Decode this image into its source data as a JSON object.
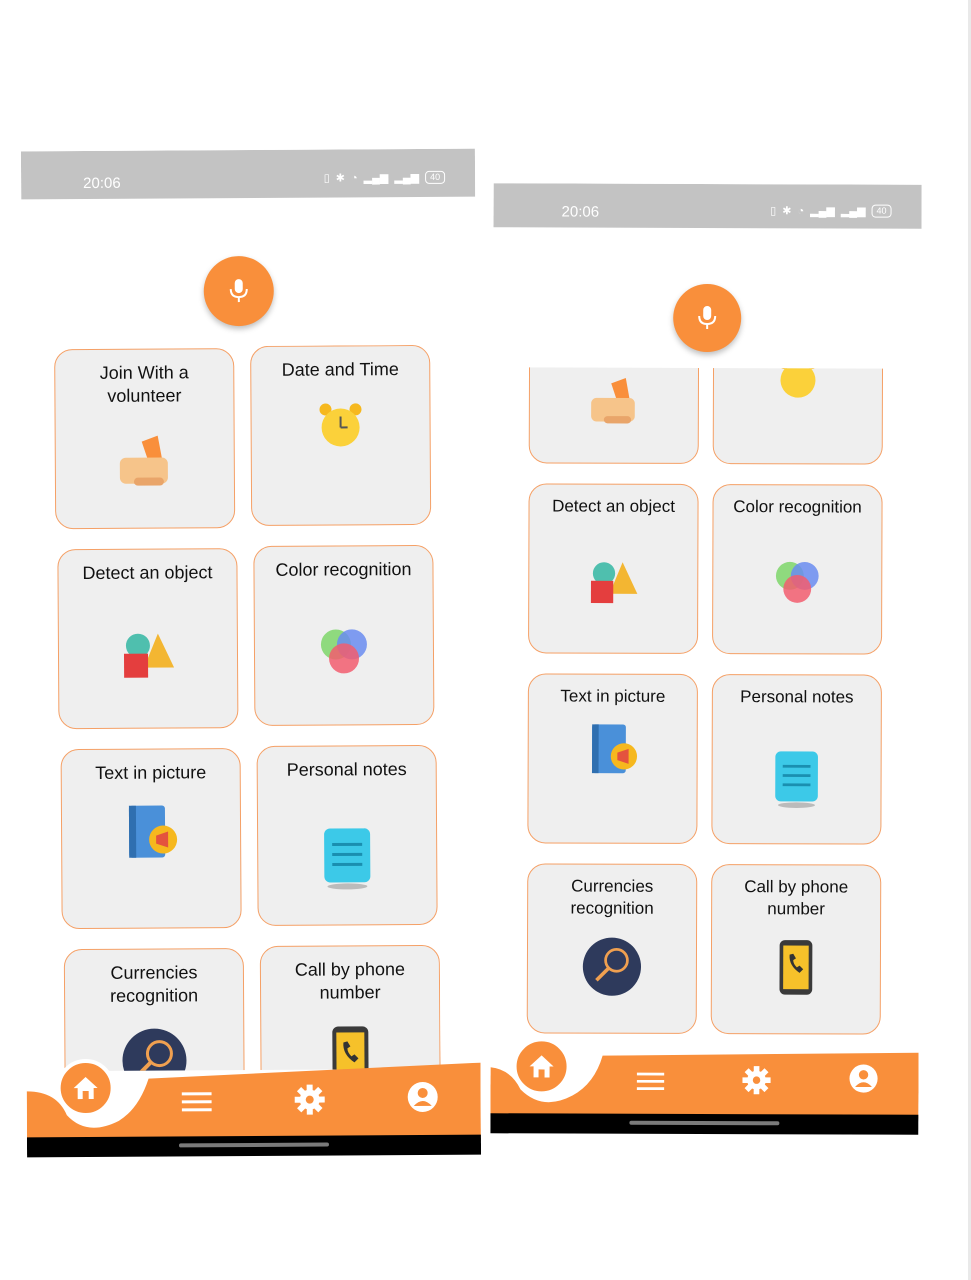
{
  "status": {
    "time": "20:06",
    "battery": "40"
  },
  "cards": {
    "volunteer": "Join With a volunteer",
    "datetime": "Date and Time",
    "detect": "Detect an object",
    "color": "Color recognition",
    "text": "Text in picture",
    "notes": "Personal notes",
    "currency": "Currencies recognition",
    "call": "Call by phone number"
  },
  "nav": {
    "items": [
      "home-icon",
      "menu-icon",
      "gear-icon",
      "user-icon"
    ]
  },
  "colors": {
    "accent": "#f98f3b",
    "card_bg": "#efefef",
    "card_border": "#f5a066",
    "status_bar": "#c3c3c3"
  }
}
